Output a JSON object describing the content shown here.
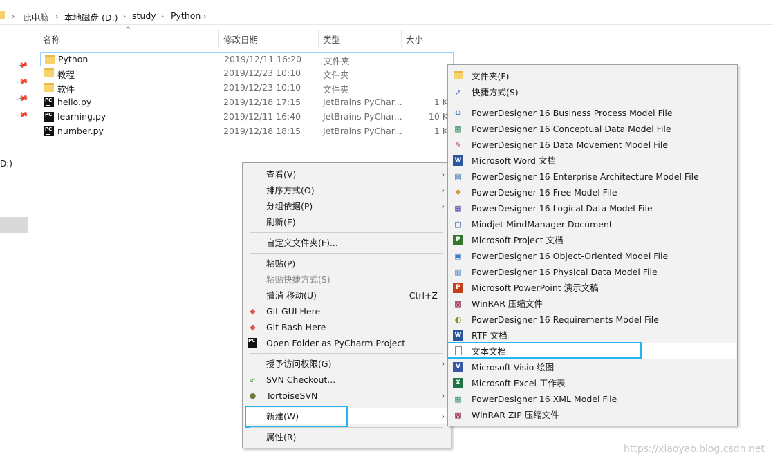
{
  "breadcrumb": {
    "items": [
      "此电脑",
      "本地磁盘 (D:)",
      "study",
      "Python"
    ]
  },
  "nav": {
    "drive_fragment": "D:)"
  },
  "columns": {
    "name": "名称",
    "modified": "修改日期",
    "type": "类型",
    "size": "大小"
  },
  "files": [
    {
      "name": "Python",
      "date": "2019/12/11 16:20",
      "type": "文件夹",
      "size": "",
      "icon": "folder-icon"
    },
    {
      "name": "教程",
      "date": "2019/12/23 10:10",
      "type": "文件夹",
      "size": "",
      "icon": "folder-icon"
    },
    {
      "name": "软件",
      "date": "2019/12/23 10:10",
      "type": "文件夹",
      "size": "",
      "icon": "folder-icon"
    },
    {
      "name": "hello.py",
      "date": "2019/12/18 17:15",
      "type": "JetBrains PyChar...",
      "size": "1 K",
      "icon": "pycharm-file-icon"
    },
    {
      "name": "learning.py",
      "date": "2019/12/11 16:40",
      "type": "JetBrains PyChar...",
      "size": "10 K",
      "icon": "pycharm-file-icon"
    },
    {
      "name": "number.py",
      "date": "2019/12/18 18:15",
      "type": "JetBrains PyChar...",
      "size": "1 K",
      "icon": "pycharm-file-icon"
    }
  ],
  "context_menu": {
    "view": "查看(V)",
    "sort": "排序方式(O)",
    "group": "分组依据(P)",
    "refresh": "刷新(E)",
    "customize": "自定义文件夹(F)...",
    "paste": "粘贴(P)",
    "paste_shortcut": "粘贴快捷方式(S)",
    "undo": "撤消 移动(U)",
    "undo_shortcut": "Ctrl+Z",
    "git_gui": "Git GUI Here",
    "git_bash": "Git Bash Here",
    "pycharm": "Open Folder as PyCharm Project",
    "grant_access": "授予访问权限(G)",
    "svn_checkout": "SVN Checkout...",
    "tortoise": "TortoiseSVN",
    "new": "新建(W)",
    "properties": "属性(R)"
  },
  "new_menu": {
    "folder": "文件夹(F)",
    "shortcut": "快捷方式(S)",
    "items": [
      "PowerDesigner 16 Business Process Model File",
      "PowerDesigner 16 Conceptual Data Model File",
      "PowerDesigner 16 Data Movement Model File",
      "Microsoft Word 文档",
      "PowerDesigner 16 Enterprise Architecture Model File",
      "PowerDesigner 16 Free Model File",
      "PowerDesigner 16 Logical Data Model File",
      "Mindjet MindManager Document",
      "Microsoft Project 文档",
      "PowerDesigner 16 Object-Oriented Model File",
      "PowerDesigner 16 Physical Data Model File",
      "Microsoft PowerPoint 演示文稿",
      "WinRAR 压缩文件",
      "PowerDesigner 16 Requirements Model File",
      "RTF 文档",
      "文本文档",
      "Microsoft Visio 绘图",
      "Microsoft Excel 工作表",
      "PowerDesigner 16 XML Model File",
      "WinRAR ZIP 压缩文件"
    ]
  },
  "watermark": "https://xiaoyao.blog.csdn.net",
  "colors": {
    "highlight": "#26b5f0",
    "menu_bg": "#f2f2f2",
    "folder": "#f6d36b"
  }
}
